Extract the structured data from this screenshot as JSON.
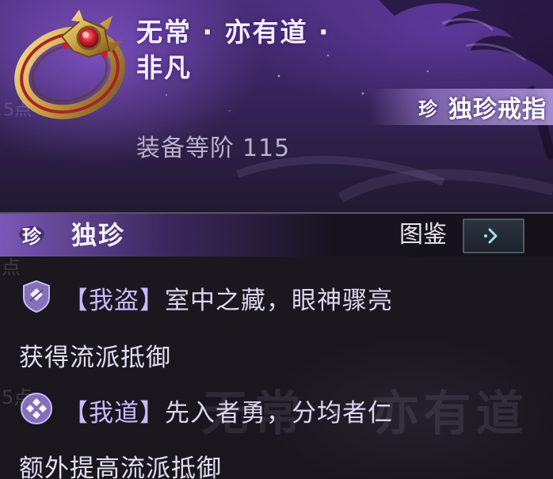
{
  "item": {
    "name_line1": "无常 · 亦有道 ·",
    "name_line2": "非凡",
    "rarity_glyph": "珍",
    "type_label": "独珍戒指",
    "tier_label": "装备等阶",
    "tier_value": "115",
    "icon": "gold-ring-icon"
  },
  "quality": {
    "glyph": "珍",
    "label": "独珍",
    "atlas_label": "图鉴",
    "atlas_button_icon": "chevron-right-icon"
  },
  "effects": [
    {
      "icon": "shield-emblem-icon",
      "tag": "【我盗】",
      "condition": "室中之藏，眼神骤亮",
      "description": "获得流派抵御"
    },
    {
      "icon": "diamond-emblem-icon",
      "tag": "【我道】",
      "condition": "先入者勇，分均者仁",
      "description": "额外提高流派抵御"
    }
  ],
  "background": {
    "watermark": "无常 · 亦有道"
  },
  "colors": {
    "header_purple": "#3b2662",
    "banner_lavender": "#c8afF5",
    "body_dark": "#1a171f",
    "effect_tag": "#c9b9ff"
  }
}
